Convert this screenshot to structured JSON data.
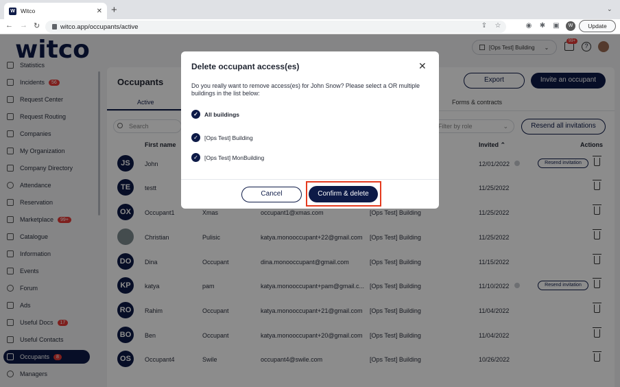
{
  "browser": {
    "tab_title": "Witco",
    "favicon": "W",
    "url": "witco.app/occupants/active",
    "profile_initial": "W",
    "update_label": "Update"
  },
  "app": {
    "logo": "witco",
    "building_selector": "[Ops Test] Building",
    "notif_badge": "99+",
    "help_label": "?"
  },
  "sidebar": {
    "items": [
      {
        "label": "Statistics",
        "icon": "chart-icon"
      },
      {
        "label": "Incidents",
        "badge": "56",
        "icon": "warning-icon"
      },
      {
        "label": "Request Center",
        "icon": "inbox-icon"
      },
      {
        "label": "Request Routing",
        "icon": "routing-icon"
      },
      {
        "label": "Companies",
        "icon": "building-icon"
      },
      {
        "label": "My Organization",
        "icon": "org-icon"
      },
      {
        "label": "Company Directory",
        "icon": "directory-icon"
      },
      {
        "label": "Attendance",
        "icon": "check-icon"
      },
      {
        "label": "Reservation",
        "icon": "calendar-icon"
      },
      {
        "label": "Marketplace",
        "badge": "99+",
        "icon": "shop-icon"
      },
      {
        "label": "Catalogue",
        "icon": "book-icon"
      },
      {
        "label": "Information",
        "icon": "info-icon"
      },
      {
        "label": "Events",
        "icon": "event-icon"
      },
      {
        "label": "Forum",
        "icon": "forum-icon"
      },
      {
        "label": "Ads",
        "icon": "tag-icon"
      },
      {
        "label": "Useful Docs",
        "badge": "17",
        "icon": "doc-icon"
      },
      {
        "label": "Useful Contacts",
        "icon": "phone-icon"
      },
      {
        "label": "Occupants",
        "badge": "8",
        "icon": "users-icon",
        "active": true
      },
      {
        "label": "Managers",
        "icon": "user-icon"
      }
    ]
  },
  "page": {
    "title": "Occupants",
    "export_label": "Export",
    "invite_label": "Invite an occupant",
    "tab_active": "Active",
    "tab_forms": "Forms & contracts",
    "search_placeholder": "Search",
    "filter_placeholder": "Filter by role",
    "resend_all_label": "Resend all invitations",
    "col_first_name": "First name",
    "col_invited": "Invited",
    "col_actions": "Actions",
    "resend_label": "Resend invitation"
  },
  "rows": [
    {
      "initials": "JS",
      "first": "John",
      "last": "",
      "email": "",
      "building": "",
      "invited": "12/01/2022",
      "resend": true
    },
    {
      "initials": "TE",
      "first": "testt",
      "last": "",
      "email": "",
      "building": "",
      "invited": "11/25/2022",
      "resend": false
    },
    {
      "initials": "OX",
      "first": "Occupant1",
      "last": "Xmas",
      "email": "occupant1@xmas.com",
      "building": "[Ops Test] Building",
      "invited": "11/25/2022",
      "resend": false
    },
    {
      "initials": "",
      "first": "Christian",
      "last": "Pulisic",
      "email": "katya.monooccupant+22@gmail.com",
      "building": "[Ops Test] Building",
      "invited": "11/25/2022",
      "resend": false,
      "photo": true
    },
    {
      "initials": "DO",
      "first": "Dina",
      "last": "Occupant",
      "email": "dina.monooccupant@gmail.com",
      "building": "[Ops Test] Building",
      "invited": "11/15/2022",
      "resend": false
    },
    {
      "initials": "KP",
      "first": "katya",
      "last": "pam",
      "email": "katya.monooccupant+pam@gmail.c...",
      "building": "[Ops Test] Building",
      "invited": "11/10/2022",
      "resend": true
    },
    {
      "initials": "RO",
      "first": "Rahim",
      "last": "Occupant",
      "email": "katya.monooccupant+21@gmail.com",
      "building": "[Ops Test] Building",
      "invited": "11/04/2022",
      "resend": false
    },
    {
      "initials": "BO",
      "first": "Ben",
      "last": "Occupant",
      "email": "katya.monooccupant+20@gmail.com",
      "building": "[Ops Test] Building",
      "invited": "11/04/2022",
      "resend": false
    },
    {
      "initials": "OS",
      "first": "Occupant4",
      "last": "Swile",
      "email": "occupant4@swile.com",
      "building": "[Ops Test] Building",
      "invited": "10/26/2022",
      "resend": false
    }
  ],
  "modal": {
    "title": "Delete occupant access(es)",
    "body": "Do you really want to remove access(es) for John Snow? Please select a OR multiple buildings in the list below:",
    "options": [
      "All buildings",
      "[Ops Test] Building",
      "[Ops Test] MonBuilding"
    ],
    "cancel_label": "Cancel",
    "confirm_label": "Confirm & delete"
  }
}
